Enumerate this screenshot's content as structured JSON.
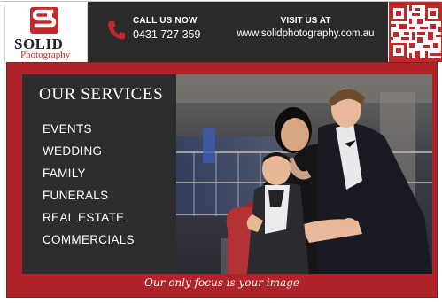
{
  "brand": {
    "name": "SOLID",
    "subtitle": "Photography",
    "accent_color": "#c0282c",
    "dark_color": "#2a2a2a"
  },
  "contact": {
    "call_label": "CALL US NOW",
    "phone": "0431 727 359",
    "visit_label": "VISIT US AT",
    "website": "www.solidphotography.com.au"
  },
  "services": {
    "title": "OUR SERVICES",
    "items": [
      "EVENTS",
      "WEDDING",
      "FAMILY",
      "FUNERALS",
      "REAL ESTATE",
      "COMMERCIALS"
    ]
  },
  "tagline": "Our only focus is your image",
  "icons": {
    "phone": "phone-icon",
    "logo": "logo-mark-icon",
    "qr": "qr-code"
  }
}
